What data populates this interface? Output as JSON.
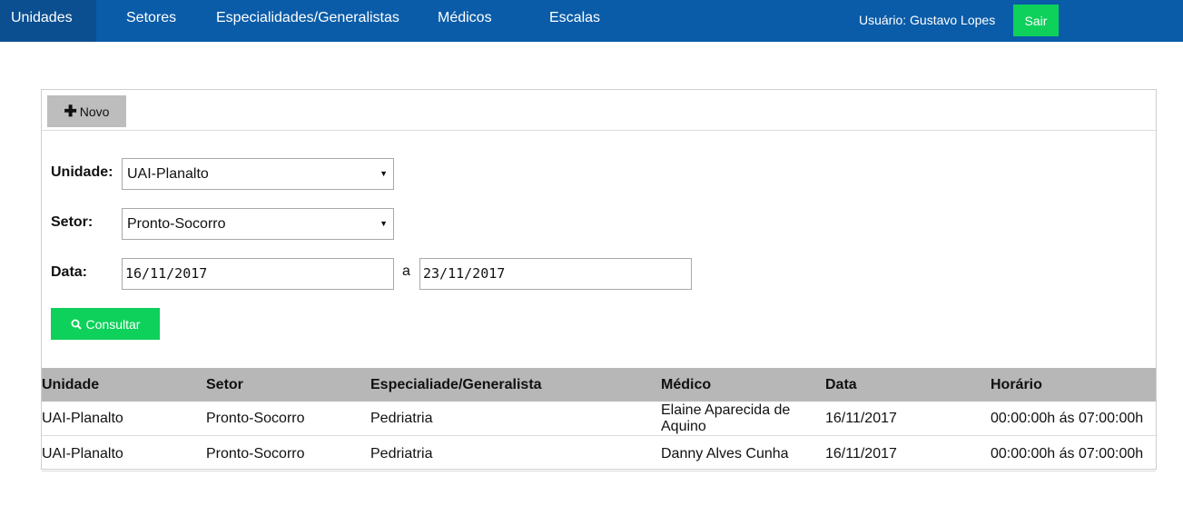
{
  "nav": {
    "items": [
      {
        "label": "Unidades"
      },
      {
        "label": "Setores"
      },
      {
        "label": "Especialidades/Generalistas"
      },
      {
        "label": "Médicos"
      },
      {
        "label": "Escalas"
      }
    ],
    "user_label": "Usuário: Gustavo Lopes",
    "logout_label": "Sair"
  },
  "colors": {
    "nav_bg": "#0a5ca8",
    "accent_green": "#0dd15a",
    "header_gray": "#b7b7b7"
  },
  "toolbar": {
    "new_label": "Novo",
    "new_icon": "plus-icon"
  },
  "filters": {
    "unidade_label": "Unidade:",
    "unidade_value": "UAI-Planalto",
    "setor_label": "Setor:",
    "setor_value": "Pronto-Socorro",
    "data_label": "Data:",
    "date_from": "16/11/2017",
    "date_sep": "a",
    "date_to": "23/11/2017",
    "search_label": "Consultar",
    "search_icon": "search-icon"
  },
  "table": {
    "headers": [
      "Unidade",
      "Setor",
      "Especialiade/Generalista",
      "Médico",
      "Data",
      "Horário"
    ],
    "rows": [
      [
        "UAI-Planalto",
        "Pronto-Socorro",
        "Pedriatria",
        "Elaine Aparecida de Aquino",
        "16/11/2017",
        "00:00:00h ás 07:00:00h"
      ],
      [
        "UAI-Planalto",
        "Pronto-Socorro",
        "Pedriatria",
        "Danny Alves Cunha",
        "16/11/2017",
        "00:00:00h ás 07:00:00h"
      ]
    ]
  }
}
